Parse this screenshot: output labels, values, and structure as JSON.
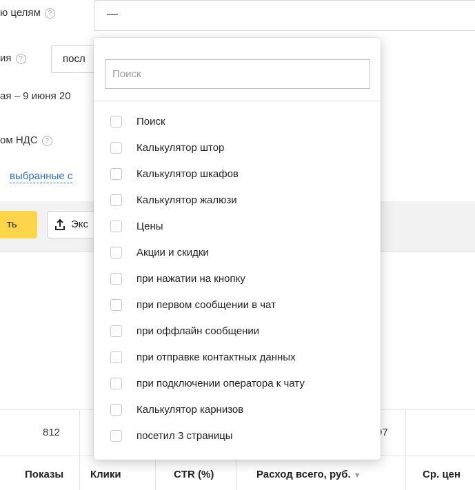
{
  "filters": {
    "goals_label": "ю целям",
    "goals_value": "—",
    "period_label": "ия",
    "period_value": "посл",
    "date_range": "ая – 9 июня 20",
    "vat_label": "ом НДС",
    "selected_link": "выбранные с"
  },
  "toolbar": {
    "apply_label": "ть",
    "export_label": "Экс"
  },
  "goals_dropdown": {
    "search_placeholder": "Поиск",
    "options": [
      "Поиск",
      "Калькулятор штор",
      "Калькулятор шкафов",
      "Калькулятор жалюзи",
      "Цены",
      "Акции и скидки",
      "при нажатии на кнопку",
      "при первом сообщении в чат",
      "при оффлайн сообщении",
      "при отправке контактных данных",
      "при подключении оператора к чату",
      "Калькулятор карнизов",
      "посетил 3 страницы"
    ]
  },
  "table": {
    "totals": {
      "impressions": "812",
      "spend_fragment": "97"
    },
    "headers": [
      "Показы",
      "Клики",
      "CTR (%)",
      "Расход всего, руб.",
      "Ср. цен"
    ],
    "sort_indicator": "▼"
  }
}
